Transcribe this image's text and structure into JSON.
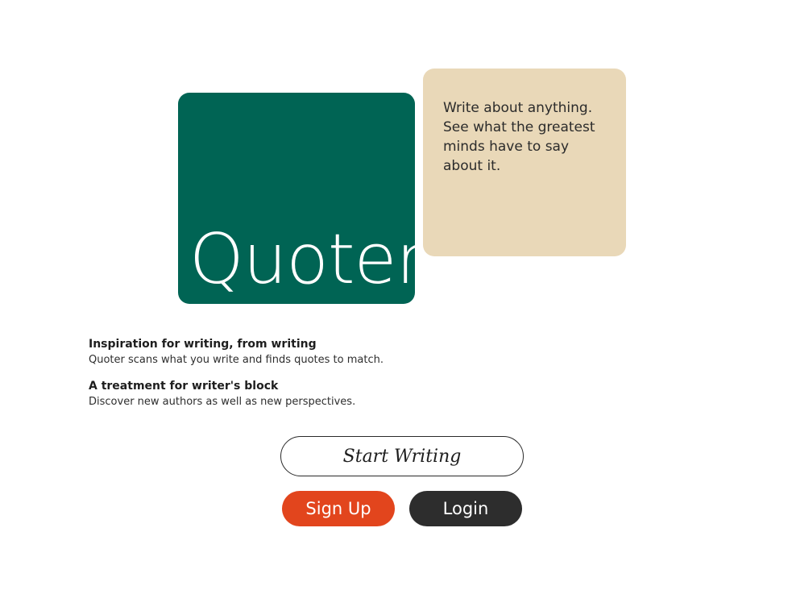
{
  "logo": {
    "text": "Quoter",
    "color": "#006454"
  },
  "tagline": {
    "text": "Write about anything. See what the greatest minds have to say about it.",
    "color": "#e9d8b8"
  },
  "features": [
    {
      "title": "Inspiration for writing, from writing",
      "description": "Quoter scans what you write and finds quotes to match."
    },
    {
      "title": "A treatment for writer's block",
      "description": "Discover new authors as well as new perspectives."
    }
  ],
  "actions": {
    "start_writing": "Start Writing",
    "sign_up": "Sign Up",
    "login": "Login"
  },
  "colors": {
    "brand_green": "#006454",
    "tagline_bg": "#e9d8b8",
    "sign_up_bg": "#e2451d",
    "login_bg": "#2d2d2d"
  }
}
